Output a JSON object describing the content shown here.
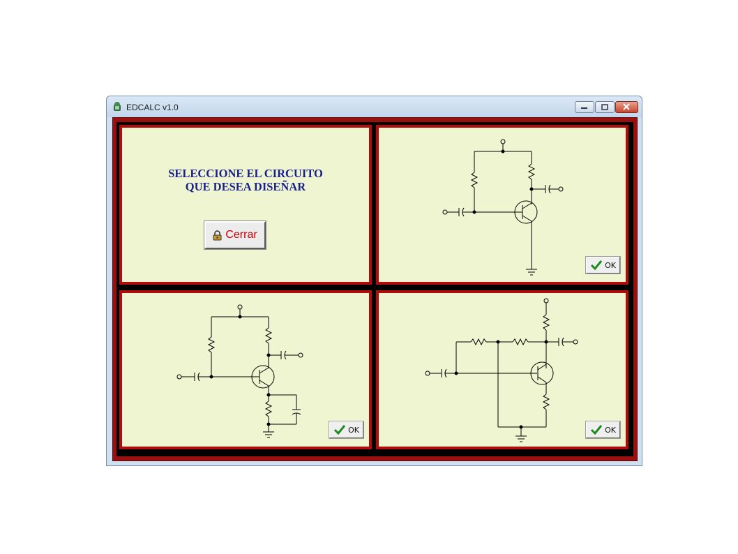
{
  "window": {
    "title": "EDCALC v1.0"
  },
  "panel_select": {
    "heading_line1": "SELECCIONE EL CIRCUITO",
    "heading_line2": "QUE DESEA DISEÑAR",
    "close_button_label": "Cerrar",
    "close_button_icon": "padlock-icon"
  },
  "circuits": [
    {
      "ok_label": "OK",
      "icon": "checkmark-icon"
    },
    {
      "ok_label": "OK",
      "icon": "checkmark-icon"
    },
    {
      "ok_label": "OK",
      "icon": "checkmark-icon"
    }
  ],
  "colors": {
    "panel_bg": "#eef5d0",
    "panel_border": "#b10c0c",
    "heading": "#1a1f8c",
    "close_label": "#c40000",
    "check": "#1c8a1c"
  }
}
